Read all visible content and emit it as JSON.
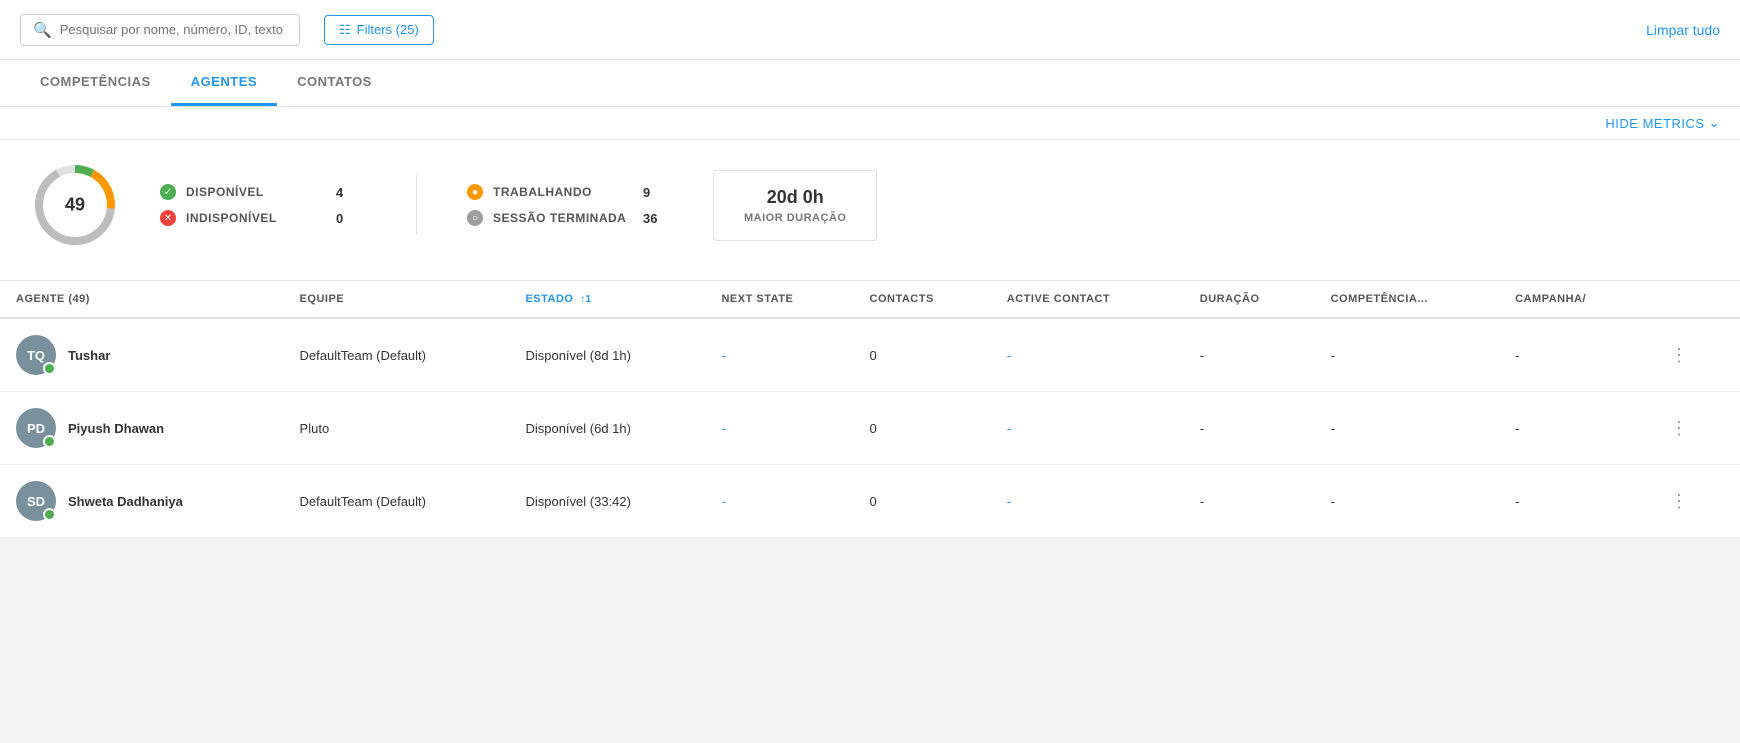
{
  "search": {
    "placeholder": "Pesquisar por nome, número, ID, texto ou"
  },
  "filter_btn": "Filters (25)",
  "clear_btn": "Limpar tudo",
  "tabs": [
    {
      "id": "competencias",
      "label": "COMPETÊNCIAS",
      "active": false
    },
    {
      "id": "agentes",
      "label": "AGENTES",
      "active": true
    },
    {
      "id": "contatos",
      "label": "CONTATOS",
      "active": false
    }
  ],
  "hide_metrics_btn": "HIDE METRICS",
  "metrics": {
    "donut_center": "49",
    "disponivel_label": "DISPONÍVEL",
    "disponivel_value": "4",
    "indisponivel_label": "INDISPONÍVEL",
    "indisponivel_value": "0",
    "trabalhando_label": "TRABALHANDO",
    "trabalhando_value": "9",
    "sessao_label": "SESSÃO TERMINADA",
    "sessao_value": "36",
    "duration_time": "20d 0h",
    "duration_label": "MAIOR DURAÇÃO"
  },
  "table": {
    "columns": [
      {
        "id": "agente",
        "label": "AGENTE (49)",
        "active": false
      },
      {
        "id": "equipe",
        "label": "EQUIPE",
        "active": false
      },
      {
        "id": "estado",
        "label": "ESTADO",
        "active": true,
        "sort": "↑1"
      },
      {
        "id": "next_state",
        "label": "NEXT STATE",
        "active": false
      },
      {
        "id": "contacts",
        "label": "CONTACTS",
        "active": false
      },
      {
        "id": "active_contact",
        "label": "ACTIVE CONTACT",
        "active": false
      },
      {
        "id": "duracao",
        "label": "DURAÇÃO",
        "active": false
      },
      {
        "id": "competencia",
        "label": "COMPETÊNCIA...",
        "active": false
      },
      {
        "id": "campanha",
        "label": "CAMPANHA/",
        "active": false
      }
    ],
    "rows": [
      {
        "initials": "TQ",
        "name": "Tushar",
        "team": "DefaultTeam (Default)",
        "estado": "Disponível (8d 1h)",
        "next_state": "-",
        "contacts": "0",
        "active_contact": "-",
        "duracao": "-",
        "competencia": "-",
        "campanha": "-"
      },
      {
        "initials": "PD",
        "name": "Piyush Dhawan",
        "team": "Pluto",
        "estado": "Disponível (6d 1h)",
        "next_state": "-",
        "contacts": "0",
        "active_contact": "-",
        "duracao": "-",
        "competencia": "-",
        "campanha": "-"
      },
      {
        "initials": "SD",
        "name": "Shweta Dadhaniya",
        "team": "DefaultTeam (Default)",
        "estado": "Disponível (33:42)",
        "next_state": "-",
        "contacts": "0",
        "active_contact": "-",
        "duracao": "-",
        "competencia": "-",
        "campanha": "-"
      }
    ]
  }
}
